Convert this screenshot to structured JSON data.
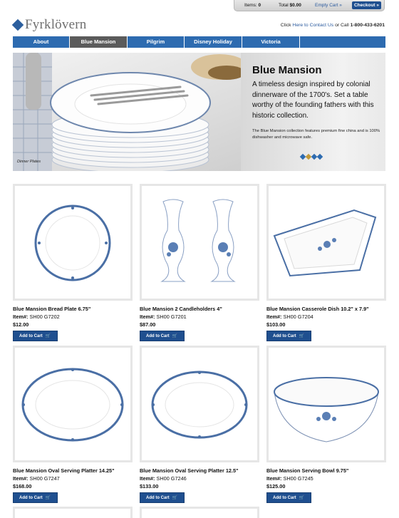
{
  "cart": {
    "items_label": "Items:",
    "items_count": "0",
    "total_label": "Total",
    "total_value": "$0.00",
    "empty_label": "Empty Cart »",
    "checkout_label": "Checkout »"
  },
  "brand": {
    "name": "Fyrklövern"
  },
  "contact": {
    "prefix": "Click",
    "link": "Here to Contact Us",
    "middle": "or Call",
    "phone": "1-800-433-6201"
  },
  "nav": {
    "tabs": [
      {
        "label": "About"
      },
      {
        "label": "Blue Mansion"
      },
      {
        "label": "Pilgrim"
      },
      {
        "label": "Disney Holiday"
      },
      {
        "label": "Victoria"
      }
    ]
  },
  "hero": {
    "title": "Blue Mansion",
    "tagline": "A timeless design inspired by colonial dinnerware of the 1700's. Set a table worthy of the founding fathers with this historic collection.",
    "description": "The Blue Mansion collection features premium fine china and is 100% dishwasher and microwave safe.",
    "caption": "Dinner Plates"
  },
  "product_labels": {
    "item_label": "Item#:",
    "add_to_cart": "Add to Cart"
  },
  "products": [
    {
      "name": "Blue Mansion Bread Plate 6.75\"",
      "item": "SH00 G7202",
      "price": "$12.00",
      "icon": "round-plate"
    },
    {
      "name": "Blue Mansion 2 Candleholders 4\"",
      "item": "SH00 G7201",
      "price": "$87.00",
      "icon": "candleholders"
    },
    {
      "name": "Blue Mansion Casserole Dish 10.2\" x 7.9\"",
      "item": "SH00 G7204",
      "price": "$103.00",
      "icon": "casserole-dish"
    },
    {
      "name": "Blue Mansion Oval Serving Platter 14.25\"",
      "item": "SH00 G7247",
      "price": "$168.00",
      "icon": "oval-platter"
    },
    {
      "name": "Blue Mansion Oval Serving Platter 12.5\"",
      "item": "SH00 G7246",
      "price": "$133.00",
      "icon": "oval-platter"
    },
    {
      "name": "Blue Mansion Serving Bowl 9.75\"",
      "item": "SH00 G7245",
      "price": "$125.00",
      "icon": "serving-bowl"
    }
  ],
  "colors": {
    "accent": "#2d6bb0",
    "active_tab": "#5b5b5b",
    "button": "#1f4f8f"
  }
}
